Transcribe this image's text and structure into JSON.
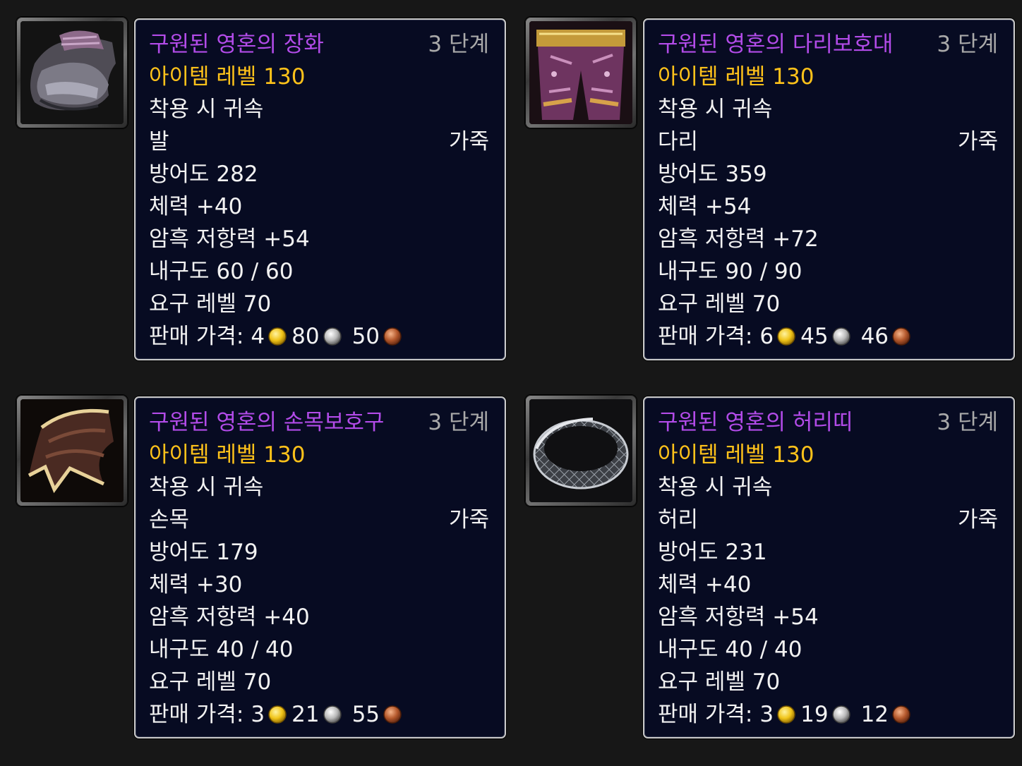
{
  "items": [
    {
      "icon": "boots-icon",
      "name": "구원된 영혼의 장화",
      "tier": "3 단계",
      "item_level": "아이템 레벨 130",
      "binding": "착용 시 귀속",
      "slot": "발",
      "material": "가죽",
      "armor": "방어도 282",
      "stamina": "체력 +40",
      "shadow_resist": "암흑 저항력 +54",
      "durability": "내구도 60 / 60",
      "required_level": "요구 레벨 70",
      "sell_label": "판매 가격:",
      "gold": "4",
      "silver": "80",
      "copper": "50"
    },
    {
      "icon": "leggings-icon",
      "name": "구원된 영혼의 다리보호대",
      "tier": "3 단계",
      "item_level": "아이템 레벨 130",
      "binding": "착용 시 귀속",
      "slot": "다리",
      "material": "가죽",
      "armor": "방어도 359",
      "stamina": "체력 +54",
      "shadow_resist": "암흑 저항력 +72",
      "durability": "내구도 90 / 90",
      "required_level": "요구 레벨 70",
      "sell_label": "판매 가격:",
      "gold": "6",
      "silver": "45",
      "copper": "46"
    },
    {
      "icon": "bracers-icon",
      "name": "구원된 영혼의 손목보호구",
      "tier": "3 단계",
      "item_level": "아이템 레벨 130",
      "binding": "착용 시 귀속",
      "slot": "손목",
      "material": "가죽",
      "armor": "방어도 179",
      "stamina": "체력 +30",
      "shadow_resist": "암흑 저항력 +40",
      "durability": "내구도 40 / 40",
      "required_level": "요구 레벨 70",
      "sell_label": "판매 가격:",
      "gold": "3",
      "silver": "21",
      "copper": "55"
    },
    {
      "icon": "belt-icon",
      "name": "구원된 영혼의 허리띠",
      "tier": "3 단계",
      "item_level": "아이템 레벨 130",
      "binding": "착용 시 귀속",
      "slot": "허리",
      "material": "가죽",
      "armor": "방어도 231",
      "stamina": "체력 +40",
      "shadow_resist": "암흑 저항력 +54",
      "durability": "내구도 40 / 40",
      "required_level": "요구 레벨 70",
      "sell_label": "판매 가격:",
      "gold": "3",
      "silver": "19",
      "copper": "12"
    }
  ],
  "colors": {
    "background": "#171717",
    "tooltip_bg": "#070b22",
    "tooltip_border": "#c9c9c9",
    "item_name_epic": "#b24be8",
    "item_level": "#ffc21a",
    "tier_text": "#a9a9a9",
    "body_text": "#f2f2f2",
    "gold_coin": "#f0c419",
    "silver_coin": "#b8b8b8",
    "copper_coin": "#b4582c"
  }
}
